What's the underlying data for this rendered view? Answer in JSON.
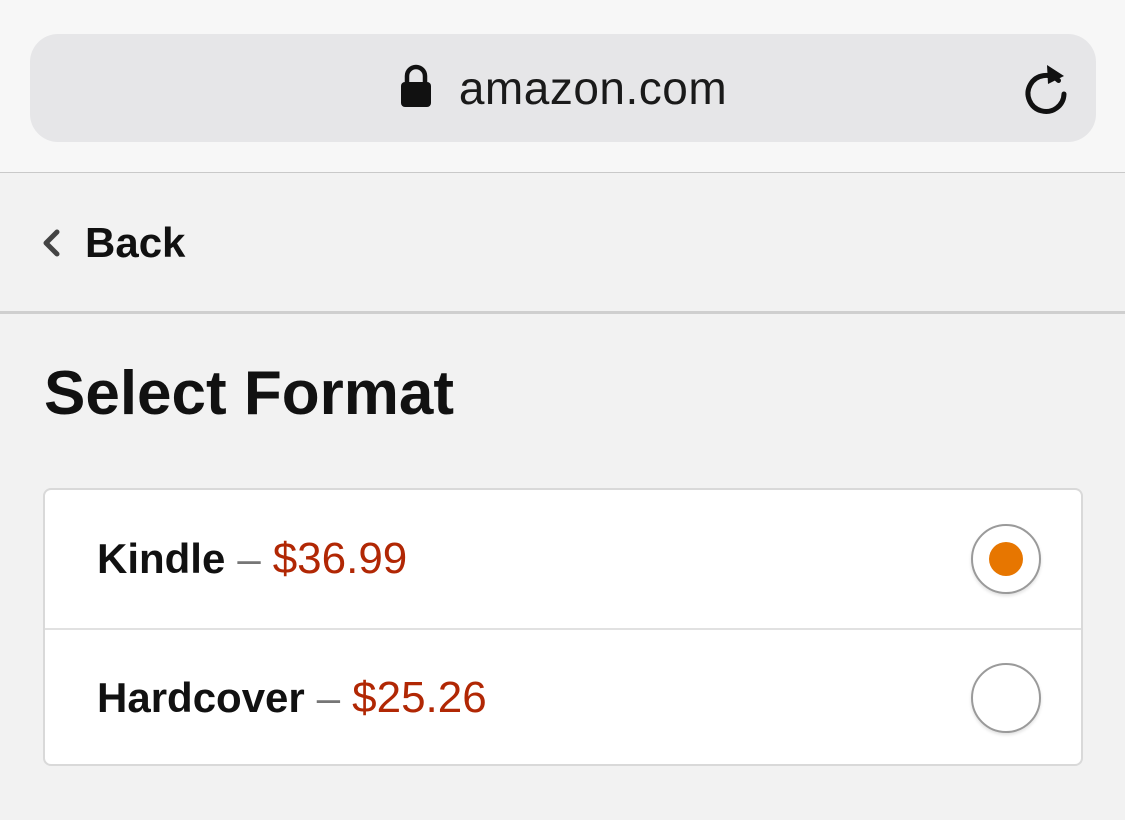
{
  "browser": {
    "url": "amazon.com",
    "icons": {
      "lock": "lock-icon",
      "reload": "reload-icon"
    }
  },
  "nav": {
    "back_label": "Back",
    "icon": "chevron-left-icon"
  },
  "page": {
    "title": "Select Format"
  },
  "formats": [
    {
      "name": "Kindle",
      "separator": "–",
      "price": "$36.99",
      "selected": true
    },
    {
      "name": "Hardcover",
      "separator": "–",
      "price": "$25.26",
      "selected": false
    }
  ],
  "colors": {
    "price": "#b12704",
    "radio_selected": "#e77600",
    "radio_border": "#9a9a9a",
    "background": "#f2f2f2"
  }
}
